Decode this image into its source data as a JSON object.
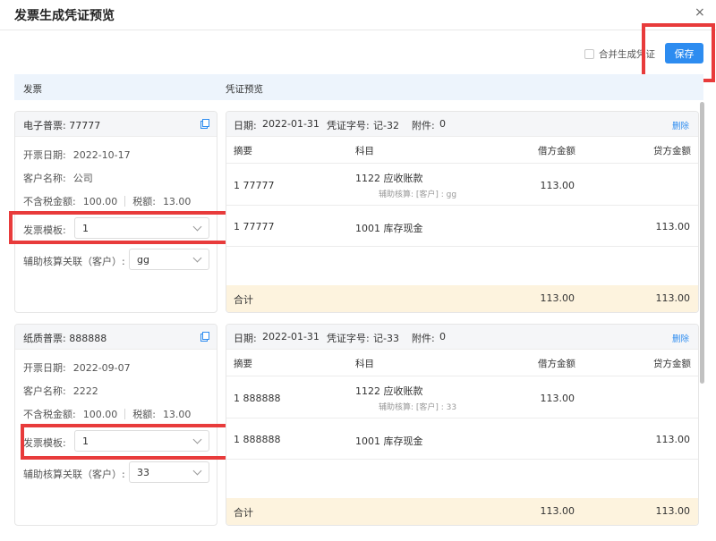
{
  "dialog": {
    "title": "发票生成凭证预览",
    "close": "×"
  },
  "toolbar": {
    "merge_label": "合并生成凭证",
    "save_label": "保存"
  },
  "columns": {
    "invoice": "发票",
    "voucher": "凭证预览"
  },
  "labels": {
    "issue_date": "开票日期:",
    "customer": "客户名称:",
    "amount_ex_tax": "不含税金额:",
    "tax": "税额:",
    "template": "发票模板:",
    "aux_link": "辅助核算关联（客户）:",
    "summary": "摘要",
    "subject": "科目",
    "debit": "借方金额",
    "credit": "贷方金额",
    "total": "合计",
    "delete": "删除",
    "date": "日期:",
    "voucher_no": "凭证字号:",
    "attachments": "附件:"
  },
  "invoices": [
    {
      "header": "电子普票: 77777",
      "issue_date": "2022-10-17",
      "customer": "公司",
      "amount_ex_tax": "100.00",
      "tax": "13.00",
      "template": "1",
      "aux": "gg"
    },
    {
      "header": "纸质普票: 888888",
      "issue_date": "2022-09-07",
      "customer": "2222",
      "amount_ex_tax": "100.00",
      "tax": "13.00",
      "template": "1",
      "aux": "33"
    }
  ],
  "vouchers": [
    {
      "date": "2022-01-31",
      "voucher_no": "记-32",
      "attachments": "0",
      "entries": [
        {
          "summary": "1 77777",
          "subject": "1122 应收账款",
          "aux": "辅助核算: [客户] : gg",
          "debit": "113.00",
          "credit": ""
        },
        {
          "summary": "1 77777",
          "subject": "1001 库存现金",
          "aux": "",
          "debit": "",
          "credit": "113.00"
        }
      ],
      "total_debit": "113.00",
      "total_credit": "113.00"
    },
    {
      "date": "2022-01-31",
      "voucher_no": "记-33",
      "attachments": "0",
      "entries": [
        {
          "summary": "1 888888",
          "subject": "1122 应收账款",
          "aux": "辅助核算: [客户] : 33",
          "debit": "113.00",
          "credit": ""
        },
        {
          "summary": "1 888888",
          "subject": "1001 库存现金",
          "aux": "",
          "debit": "",
          "credit": "113.00"
        }
      ],
      "total_debit": "113.00",
      "total_credit": "113.00"
    }
  ],
  "colors": {
    "accent": "#2d8cf0",
    "highlight": "#e83b3b",
    "total_bg": "#fdf3de",
    "header_bg": "#edf4fc"
  }
}
